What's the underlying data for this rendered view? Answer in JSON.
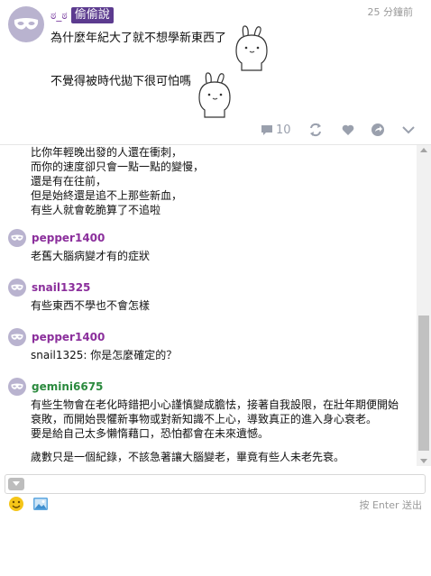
{
  "post": {
    "nickname": "ಠ_ಠ",
    "tag": "偷偷說",
    "time": "25 分鐘前",
    "line1": "為什麼年紀大了就不想學新東西了",
    "line2": "不覺得被時代拋下很可怕嗎",
    "comment_count": "10"
  },
  "chat": {
    "partial_message": [
      "比你年輕晚出發的人還在衝刺，",
      "而你的速度卻只會一點一點的變慢，",
      "還是有在往前，",
      "但是始終還是追不上那些新血，",
      "有些人就會乾脆算了不追啦"
    ],
    "messages": [
      {
        "user": "pepper1400",
        "color": "#8b2f9c",
        "lines": [
          "老舊大腦病變才有的症狀"
        ]
      },
      {
        "user": "snail1325",
        "color": "#8b2f9c",
        "lines": [
          "有些東西不學也不會怎樣"
        ]
      },
      {
        "user": "pepper1400",
        "color": "#8b2f9c",
        "lines": [
          "snail1325: 你是怎麼確定的？"
        ]
      },
      {
        "user": "gemini6675",
        "color": "#2b8a3e",
        "lines": [
          "有些生物會在老化時錯把小心謹慎變成膽怯，接著自我設限，在壯年期便開始",
          "衰敗，而開始畏懼新事物或對新知識不上心，導致真正的進入身心衰老。",
          "要是給自己太多懶惰藉口，恐怕都會在未來遺憾。",
          "",
          "歲數只是一個紀錄，不該急著讓大腦變老，畢竟有些人未老先衰。"
        ]
      }
    ]
  },
  "input": {
    "value": "",
    "hint_prefix": "按",
    "hint_key": "Enter",
    "hint_suffix": "送出"
  },
  "colors": {
    "tag_bg": "#5c3b8f",
    "avatar_bg": "#b9b3cf",
    "icon_gray": "#9aa0ad"
  }
}
